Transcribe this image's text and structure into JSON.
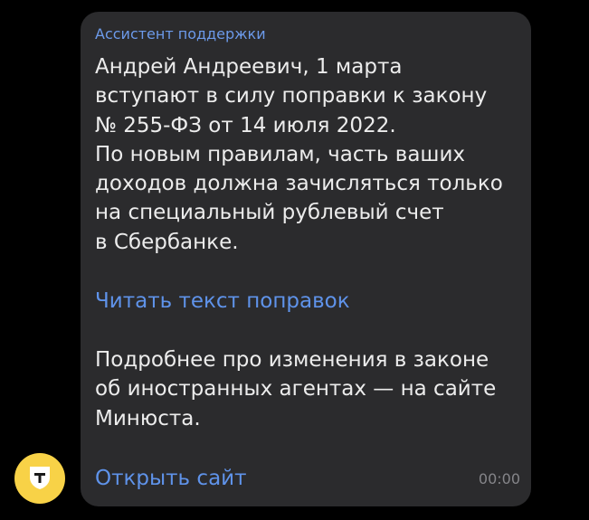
{
  "chat": {
    "avatar_icon": "bank-shield-icon",
    "avatar_color": "#F8D247",
    "message": {
      "sender": "Ассистент поддержки",
      "paragraph1": [
        "Андрей Андреевич, 1 марта",
        "вступают в силу поправки к закону",
        "№ 255-ФЗ от 14 июля 2022.",
        "По новым правилам, часть ваших",
        "доходов должна зачисляться только",
        "на специальный рублевый счет",
        "в Сбербанке."
      ],
      "link_amendments": "Читать текст поправок",
      "paragraph2": [
        "Подробнее про изменения в законе",
        "об иностранных агентах — на сайте",
        "Минюста."
      ],
      "link_site": "Открыть сайт",
      "time": "00:00"
    },
    "colors": {
      "background": "#000000",
      "bubble": "#2b2b2d",
      "text": "#ececec",
      "link": "#5f93ea",
      "sender": "#6c9aea",
      "time": "#858589"
    }
  }
}
